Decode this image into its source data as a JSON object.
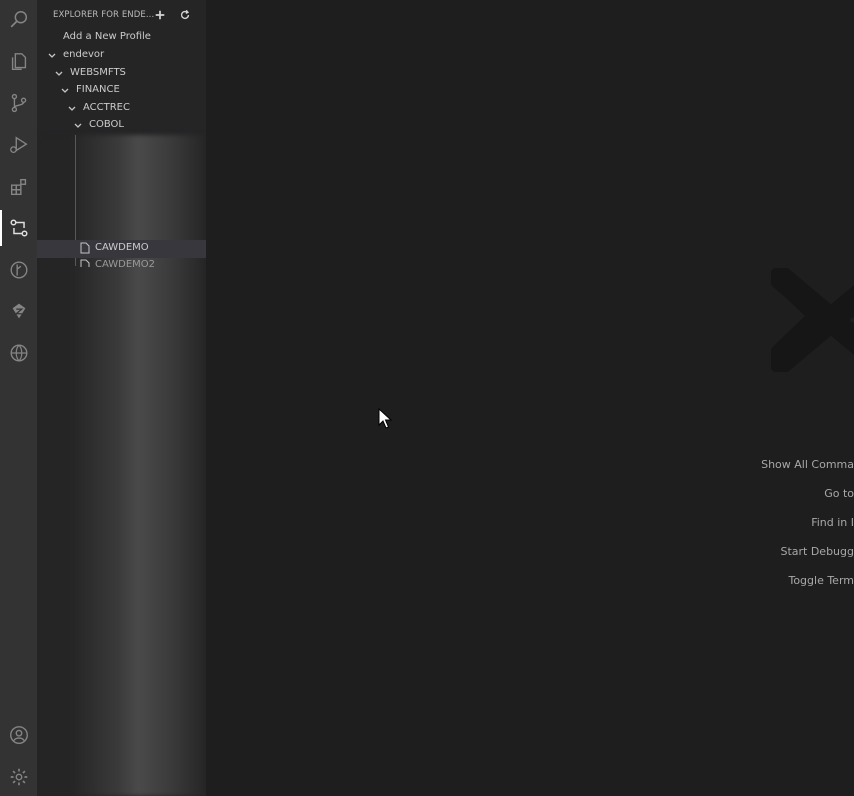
{
  "sidebar": {
    "title": "EXPLORER FOR ENDE...",
    "actions": {
      "add_icon": "plus-icon",
      "refresh_icon": "refresh-icon"
    },
    "tree": {
      "add_profile": "Add a New Profile",
      "endevor": "endevor",
      "websmfts": "WEBSMFTS",
      "finance": "FINANCE",
      "acctrec": "ACCTREC",
      "cobol": "COBOL",
      "selected_file": "CAWDEMO",
      "partial_file": "CAWDEMO2"
    }
  },
  "activitybar": {
    "icons": [
      "search-icon",
      "files-icon",
      "source-control-icon",
      "run-debug-icon",
      "extensions-icon",
      "endevor-explorer-icon",
      "git-graph-icon",
      "zowe-icon",
      "remote-explorer-icon",
      "account-icon",
      "settings-gear-icon"
    ],
    "active_index": 5
  },
  "editor": {
    "shortcuts": [
      "Show All Comma",
      "Go to",
      "Find in I",
      "Start Debugg",
      "Toggle Term"
    ]
  },
  "colors": {
    "activitybar_bg": "#333333",
    "sidebar_bg": "#252526",
    "editor_bg": "#1e1e1e",
    "selection_bg": "#37373d"
  }
}
